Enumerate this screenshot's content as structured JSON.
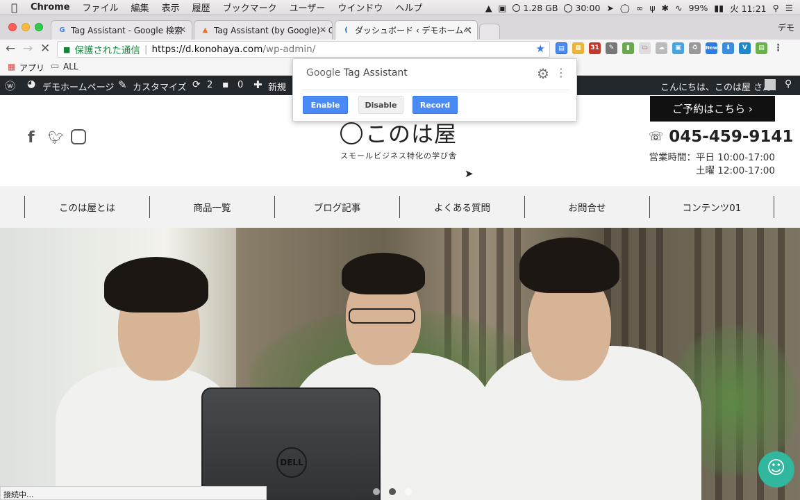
{
  "menubar": {
    "apple": "",
    "app": "Chrome",
    "items": [
      "ファイル",
      "編集",
      "表示",
      "履歴",
      "ブックマーク",
      "ユーザー",
      "ウインドウ",
      "ヘルプ"
    ],
    "memory": "1.28 GB",
    "timer": "30:00",
    "battery": "99%",
    "clock": "火 11:21"
  },
  "tabs": [
    {
      "title": "Tag Assistant - Google 検索",
      "favicon": "G"
    },
    {
      "title": "Tag Assistant (by Google) - Ch",
      "favicon": "▲"
    },
    {
      "title": "ダッシュボード ‹ デモホームペ",
      "favicon": "("
    }
  ],
  "profile": "デモ",
  "omnibox": {
    "secure_label": "保護された通信",
    "url_host": "https://d.konohaya.com",
    "url_path": "/wp-admin/"
  },
  "bookmarks": {
    "apps": "アプリ",
    "folder": "ALL"
  },
  "wp_admin_bar": {
    "site": "デモホームページ",
    "customize": "カスタマイズ",
    "updates": "2",
    "comments": "0",
    "new": "新規",
    "greeting": "こんにちは、このは屋 さん"
  },
  "site": {
    "reserve_button": "ご予約はこちら ›",
    "phone": "045-459-9141",
    "hours_weekday": "営業時間：平日 10:00-17:00",
    "hours_saturday": "土曜 12:00-17:00",
    "logo_main": "このは屋",
    "logo_sub": "スモールビジネス特化の学び舎",
    "nav": [
      "このは屋とは",
      "商品一覧",
      "ブログ記事",
      "よくある質問",
      "お問合せ",
      "コンテンツ01"
    ]
  },
  "status_text": "接続中...",
  "tag_assistant": {
    "brand": "Google",
    "product": "Tag Assistant",
    "enable": "Enable",
    "disable": "Disable",
    "record": "Record"
  },
  "colors": {
    "primary_button": "#4a8af4",
    "wp_bar": "#23282d",
    "secure_green": "#14863a"
  }
}
